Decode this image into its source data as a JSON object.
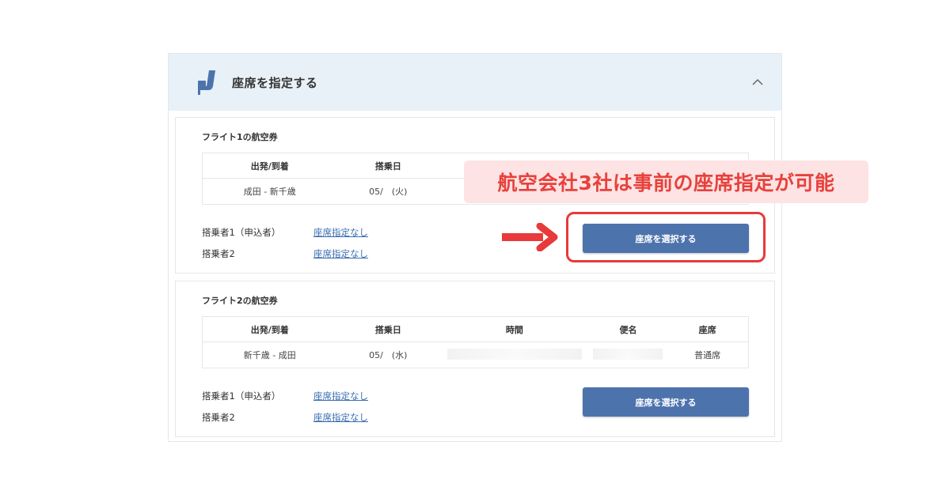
{
  "panel": {
    "title": "座席を指定する"
  },
  "table_headers": {
    "route": "出発/到着",
    "date": "搭乗日",
    "time": "時間",
    "flight_no": "便名",
    "seat": "座席"
  },
  "flights": [
    {
      "title": "フライト1の航空券",
      "route": "成田 - 新千歳",
      "date": "05/　(火)",
      "time": "",
      "flight_no": "",
      "seat": "",
      "passengers": [
        {
          "label": "搭乗者1（申込者）",
          "status": "座席指定なし"
        },
        {
          "label": "搭乗者2",
          "status": "座席指定なし"
        }
      ],
      "button_label": "座席を選択する"
    },
    {
      "title": "フライト2の航空券",
      "route": "新千歳 - 成田",
      "date": "05/　(水)",
      "time": "",
      "flight_no": "",
      "seat": "普通席",
      "passengers": [
        {
          "label": "搭乗者1（申込者）",
          "status": "座席指定なし"
        },
        {
          "label": "搭乗者2",
          "status": "座席指定なし"
        }
      ],
      "button_label": "座席を選択する"
    }
  ],
  "annotation": {
    "callout_text": "航空会社3社は事前の座席指定が可能",
    "accent_color": "#e83a3a"
  },
  "colors": {
    "header_bg": "#e8f1f8",
    "button_bg": "#4d73ad",
    "link": "#3b6fb0"
  },
  "icons": {
    "header": "seat-icon",
    "collapse": "chevron-up-icon",
    "pointer": "arrow-right-icon"
  }
}
